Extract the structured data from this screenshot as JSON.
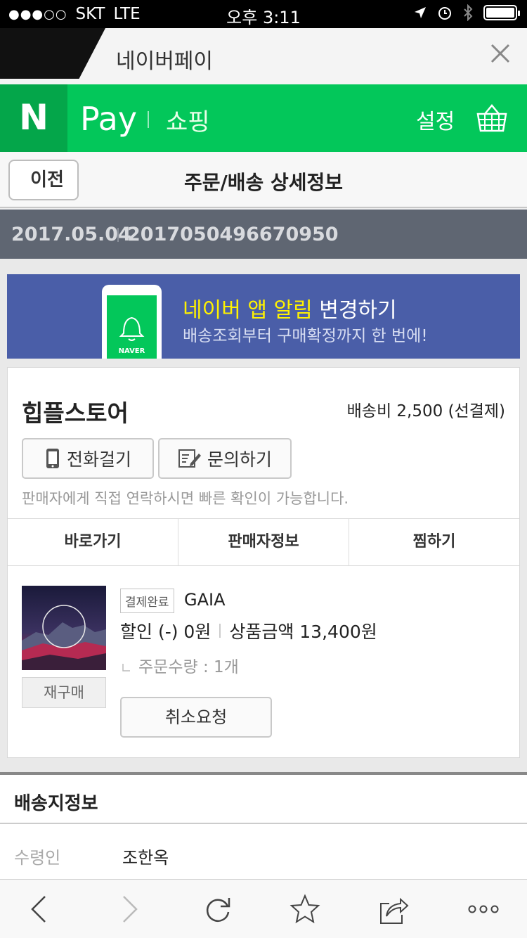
{
  "status_bar": {
    "signal": "●●●○○",
    "carrier": "SKT",
    "network": "LTE",
    "time": "오후 3:11"
  },
  "tab": {
    "title": "네이버페이"
  },
  "brand_bar": {
    "logo": "N",
    "pay": "Pay",
    "shopping": "쇼핑",
    "settings": "설정",
    "colors": {
      "green": "#03c75a",
      "dark_green": "#04a64a"
    }
  },
  "title_bar": {
    "back": "이전",
    "title": "주문/배송 상세정보"
  },
  "order": {
    "date": "2017.05.04",
    "number": "2017050496670950"
  },
  "banner": {
    "app_name": "네이버 앱 알림",
    "change": "변경하기",
    "subtitle": "배송조회부터 구매확정까지 한 번에!",
    "phone_label": "NAVER"
  },
  "store": {
    "name": "힙플스토어",
    "shipping": "배송비 2,500 (선결제)",
    "call": "전화걸기",
    "inquiry": "문의하기",
    "hint": "판매자에게 직접 연락하시면 빠른 확인이 가능합니다.",
    "tabs": [
      "바로가기",
      "판매자정보",
      "찜하기"
    ]
  },
  "product": {
    "rebuy": "재구매",
    "status": "결제완료",
    "name": "GAIA",
    "discount": "할인 (-) 0원",
    "amount": "상품금액 13,400원",
    "quantity": "주문수량 : 1개",
    "cancel": "취소요청"
  },
  "delivery": {
    "section_title": "배송지정보",
    "recipient_label": "수령인",
    "recipient": "조한옥"
  },
  "toolbar": {
    "icons": [
      "back-icon",
      "forward-icon",
      "reload-icon",
      "bookmark-icon",
      "share-icon",
      "more-icon"
    ]
  }
}
